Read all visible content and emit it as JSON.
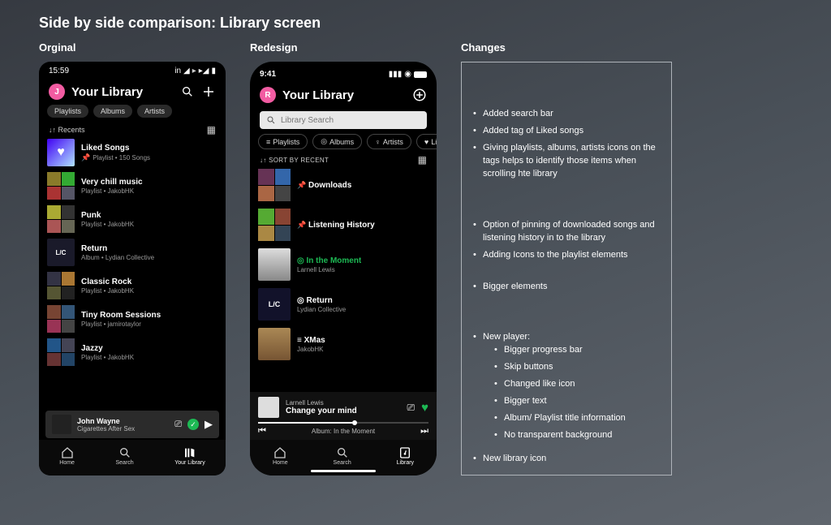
{
  "page_title": "Side by side comparison: Library screen",
  "columns": {
    "original": "Orginal",
    "redesign": "Redesign",
    "changes": "Changes"
  },
  "original": {
    "status_time": "15:59",
    "avatar_letter": "J",
    "avatar_color": "#f25ca2",
    "header_title": "Your Library",
    "chips": [
      "Playlists",
      "Albums",
      "Artists"
    ],
    "sort_label": "Recents",
    "items": [
      {
        "title": "Liked Songs",
        "subtitle": "Playlist • 150 Songs",
        "pinned": true,
        "thumb": "liked"
      },
      {
        "title": "Very chill music",
        "subtitle": "Playlist • JakobHK",
        "thumb": "grid"
      },
      {
        "title": "Punk",
        "subtitle": "Playlist • JakobHK",
        "thumb": "grid"
      },
      {
        "title": "Return",
        "subtitle": "Album • Lydian Collective",
        "thumb": "lc"
      },
      {
        "title": "Classic Rock",
        "subtitle": "Playlist • JakobHK",
        "thumb": "grid"
      },
      {
        "title": "Tiny Room Sessions",
        "subtitle": "Playlist • jamirotaylor",
        "thumb": "grid"
      },
      {
        "title": "Jazzy",
        "subtitle": "Playlist • JakobHK",
        "thumb": "grid"
      }
    ],
    "player": {
      "title": "John Wayne",
      "artist": "Cigarettes After Sex"
    },
    "nav": [
      "Home",
      "Search",
      "Your Library"
    ]
  },
  "redesign": {
    "status_time": "9:41",
    "avatar_letter": "R",
    "avatar_color": "#f25ca2",
    "header_title": "Your Library",
    "search_placeholder": "Library Search",
    "chips": [
      {
        "icon": "playlist",
        "label": "Playlists"
      },
      {
        "icon": "album",
        "label": "Albums"
      },
      {
        "icon": "artist",
        "label": "Artists"
      },
      {
        "icon": "heart",
        "label": "Liked"
      }
    ],
    "sort_label": "SORT BY RECENT",
    "items": [
      {
        "title": "Downloads",
        "pinned": true,
        "thumb": "grid"
      },
      {
        "title": "Listening History",
        "pinned": true,
        "thumb": "grid"
      },
      {
        "title": "In the Moment",
        "subtitle": "Larnell Lewis",
        "icon": "album-green",
        "thumb": "bw"
      },
      {
        "title": "Return",
        "subtitle": "Lydian Collective",
        "icon": "album",
        "thumb": "lc"
      },
      {
        "title": "XMas",
        "subtitle": "JakobHK",
        "icon": "playlist",
        "thumb": "photo"
      }
    ],
    "player": {
      "artist": "Larnell Lewis",
      "title": "Change your mind",
      "album_line": "Album: In the Moment"
    },
    "nav": [
      "Home",
      "Search",
      "Library"
    ]
  },
  "changes": {
    "block1": [
      "Added search bar",
      "Added tag of Liked songs",
      "Giving playlists, albums, artists icons on the tags helps to identify those items when scrolling hte library"
    ],
    "block2": [
      "Option of pinning of downloaded songs and listening history in to the library",
      "Adding Icons to the playlist elements"
    ],
    "block3": [
      "Bigger elements"
    ],
    "block4_head": "New player:",
    "block4_sub": [
      "Bigger progress bar",
      "Skip buttons",
      "Changed like icon",
      "Bigger text",
      "Album/ Playlist title information",
      "No transparent background"
    ],
    "block5": [
      "New library icon"
    ]
  }
}
